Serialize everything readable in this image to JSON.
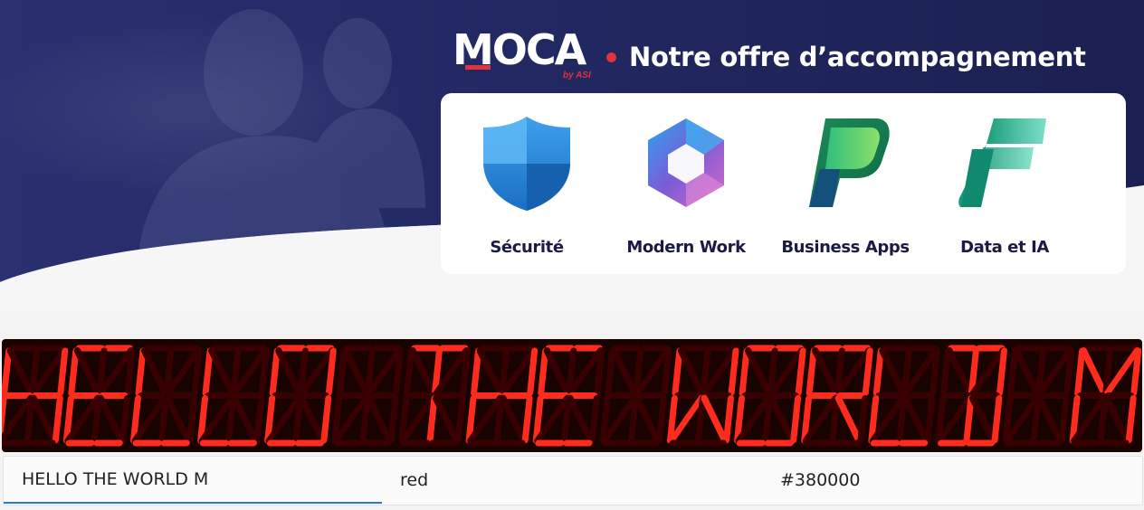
{
  "banner": {
    "logo_text": "MOCA",
    "logo_byline": "by ASI",
    "tagline": "Notre offre d’accompagnement",
    "offers": [
      {
        "label": "Sécurité",
        "icon": "defender-shield-icon"
      },
      {
        "label": "Modern Work",
        "icon": "microsoft-365-icon"
      },
      {
        "label": "Business Apps",
        "icon": "power-apps-icon"
      },
      {
        "label": "Data et IA",
        "icon": "fabric-icon"
      }
    ]
  },
  "display": {
    "text": "HELLO THE WORLD M",
    "on_color": "#ff2b1c",
    "off_color": "#380000",
    "background": "#180300"
  },
  "controls": {
    "text_value": "HELLO THE WORLD M",
    "color_value": "red",
    "background_value": "#380000"
  },
  "colors": {
    "banner_navy": "#1e2458",
    "brand_red": "#e0343a",
    "label_navy": "#1a1a45",
    "focus_blue": "#2a7ad4"
  }
}
